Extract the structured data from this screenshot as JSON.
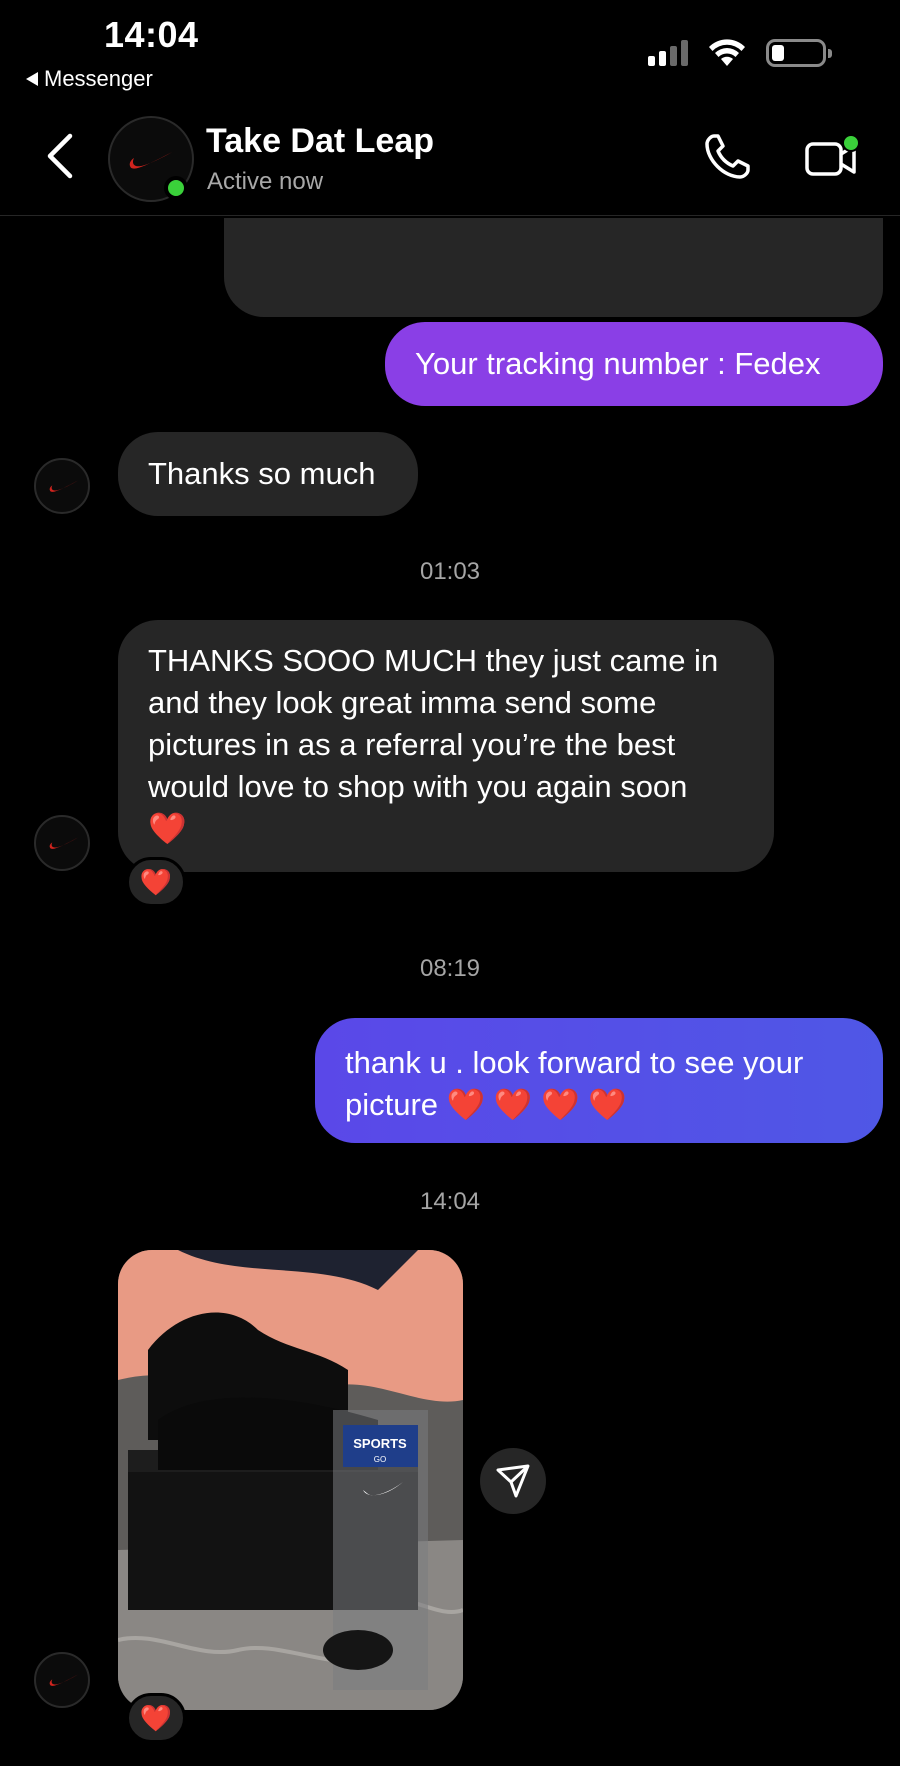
{
  "status_bar": {
    "time": "14:04",
    "back_app": "Messenger",
    "signal_bars": 4,
    "signal_strength": 2,
    "battery_level": 0.25
  },
  "header": {
    "contact_name": "Take Dat Leap",
    "contact_status": "Active now",
    "back_icon": "chevron-left-icon",
    "call_icon": "phone-icon",
    "video_icon": "video-camera-icon",
    "online_color": "#3ad13a"
  },
  "messages": [
    {
      "type": "outgoing",
      "text": "Your tracking number : Fedex",
      "color": "#8a3fe6"
    },
    {
      "type": "incoming",
      "text": "Thanks so much"
    },
    {
      "type": "timestamp",
      "text": "01:03"
    },
    {
      "type": "incoming",
      "text": "THANKS SOOO MUCH they just came in and they look great imma send some pictures in as a referral you’re the best would love to shop with you again soon",
      "emoji": "❤️",
      "reaction": "❤️"
    },
    {
      "type": "timestamp",
      "text": "08:19"
    },
    {
      "type": "outgoing",
      "text": "thank u . look forward to see your picture",
      "emoji": "❤️ ❤️ ❤️ ❤️",
      "color": "#5450e6"
    },
    {
      "type": "timestamp",
      "text": "14:04"
    },
    {
      "type": "incoming-photo",
      "photo_text": "SPORTS",
      "photo_subtext": "GO",
      "reaction": "❤️",
      "share_icon": "send-icon"
    }
  ],
  "colors": {
    "background": "#000000",
    "incoming_bubble": "#262626",
    "heart": "#e0222e"
  }
}
